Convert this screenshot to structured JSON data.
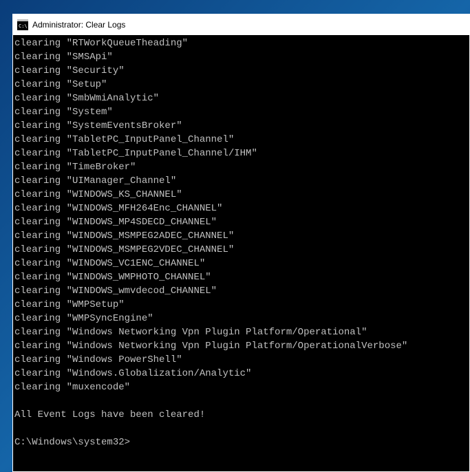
{
  "window": {
    "title": "Administrator: Clear Logs"
  },
  "terminal": {
    "clearing_prefix": "clearing",
    "logs": [
      "RTWorkQueueTheading",
      "SMSApi",
      "Security",
      "Setup",
      "SmbWmiAnalytic",
      "System",
      "SystemEventsBroker",
      "TabletPC_InputPanel_Channel",
      "TabletPC_InputPanel_Channel/IHM",
      "TimeBroker",
      "UIManager_Channel",
      "WINDOWS_KS_CHANNEL",
      "WINDOWS_MFH264Enc_CHANNEL",
      "WINDOWS_MP4SDECD_CHANNEL",
      "WINDOWS_MSMPEG2ADEC_CHANNEL",
      "WINDOWS_MSMPEG2VDEC_CHANNEL",
      "WINDOWS_VC1ENC_CHANNEL",
      "WINDOWS_WMPHOTO_CHANNEL",
      "WINDOWS_wmvdecod_CHANNEL",
      "WMPSetup",
      "WMPSyncEngine",
      "Windows Networking Vpn Plugin Platform/Operational",
      "Windows Networking Vpn Plugin Platform/OperationalVerbose",
      "Windows PowerShell",
      "Windows.Globalization/Analytic",
      "muxencode"
    ],
    "completion_message": "All Event Logs have been cleared!",
    "prompt": "C:\\Windows\\system32>"
  }
}
